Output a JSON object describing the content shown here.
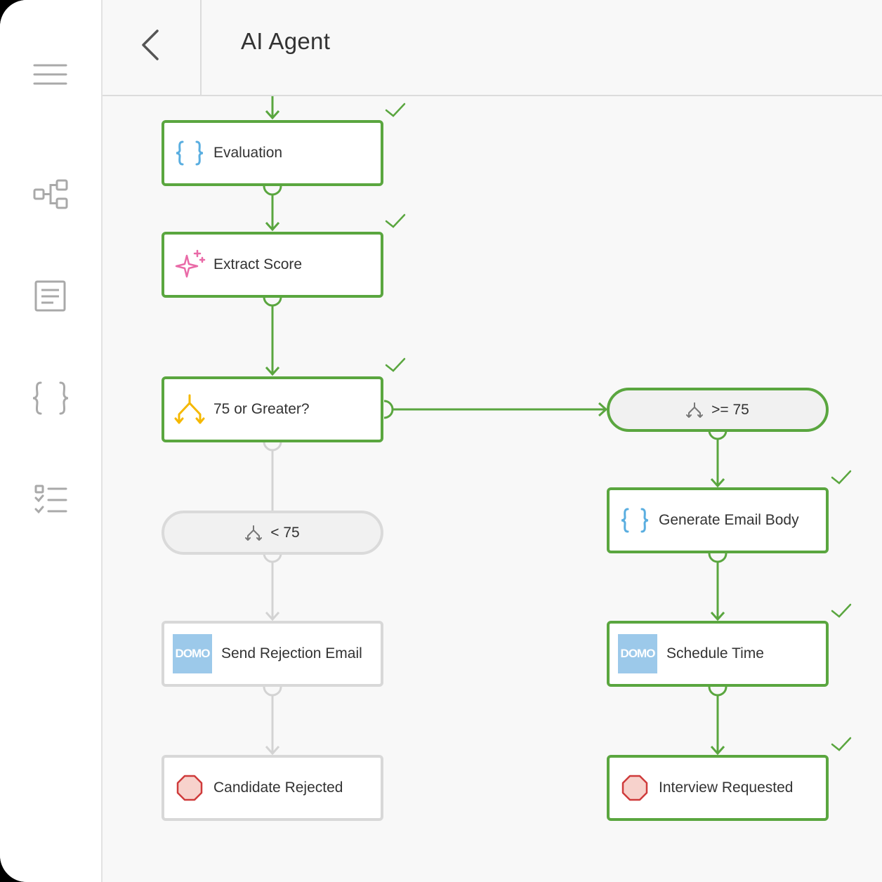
{
  "header": {
    "title": "AI Agent",
    "back_icon": "chevron-left-icon"
  },
  "sidebar": {
    "items": [
      {
        "icon": "hamburger-menu-icon"
      },
      {
        "icon": "workflow-diagram-icon"
      },
      {
        "icon": "document-icon"
      },
      {
        "icon": "curly-braces-icon"
      },
      {
        "icon": "checklist-icon"
      }
    ]
  },
  "flow": {
    "nodes": {
      "evaluation": {
        "label": "Evaluation",
        "icon": "code-braces-icon",
        "status": "complete"
      },
      "extract_score": {
        "label": "Extract Score",
        "icon": "ai-sparkle-icon",
        "status": "complete"
      },
      "condition": {
        "label": "75 or Greater?",
        "icon": "branch-icon",
        "status": "complete"
      },
      "branch_high": {
        "label": ">= 75",
        "icon": "fork-icon",
        "status": "active"
      },
      "branch_low": {
        "label": "< 75",
        "icon": "fork-icon",
        "status": "inactive"
      },
      "generate_email": {
        "label": "Generate Email Body",
        "icon": "code-braces-icon",
        "status": "complete"
      },
      "schedule_time": {
        "label": "Schedule Time",
        "icon": "domo-logo-icon",
        "logo_text": "DOMO",
        "status": "complete"
      },
      "send_rejection": {
        "label": "Send Rejection Email",
        "icon": "domo-logo-icon",
        "logo_text": "DOMO",
        "status": "inactive"
      },
      "candidate_rejected": {
        "label": "Candidate Rejected",
        "icon": "stop-octagon-icon",
        "status": "inactive"
      },
      "interview_requested": {
        "label": "Interview Requested",
        "icon": "stop-octagon-icon",
        "status": "complete"
      }
    }
  },
  "colors": {
    "active": "#5aa63f",
    "inactive": "#d8d8d8",
    "braces": "#5aaee0",
    "sparkle": "#e96aa7",
    "branch": "#f5b800",
    "stop_fill": "#f7d2cc",
    "stop_stroke": "#cf3b3b",
    "domo_bg": "#9cc9ea"
  }
}
